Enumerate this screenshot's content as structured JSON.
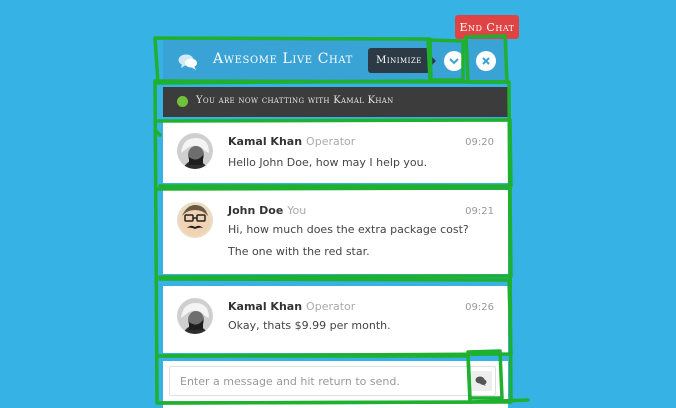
{
  "end_chat": {
    "label": "End Chat"
  },
  "header": {
    "title": "Awesome Live Chat",
    "minimize_tooltip": "Minimize",
    "icon": "chat-bubble-icon"
  },
  "status": {
    "text": "You are now chatting with Kamal Khan",
    "dot_color": "#73c13a"
  },
  "messages": [
    {
      "name": "Kamal Khan",
      "role": "Operator",
      "time": "09:20",
      "lines": [
        "Hello John Doe, how may I help you."
      ]
    },
    {
      "name": "John Doe",
      "role": "You",
      "time": "09:21",
      "lines": [
        "Hi, how much does the extra package cost?",
        "The one with the red star."
      ]
    },
    {
      "name": "Kamal Khan",
      "role": "Operator",
      "time": "09:26",
      "lines": [
        "Okay, thats $9.99 per month."
      ]
    }
  ],
  "input": {
    "placeholder": "Enter a message and hit return to send.",
    "value": ""
  },
  "colors": {
    "background": "#37b2e5",
    "header": "#3aa3d6",
    "status_bar": "#3c3c3c",
    "end_chat": "#e04343",
    "annotation": "#1fb030"
  }
}
